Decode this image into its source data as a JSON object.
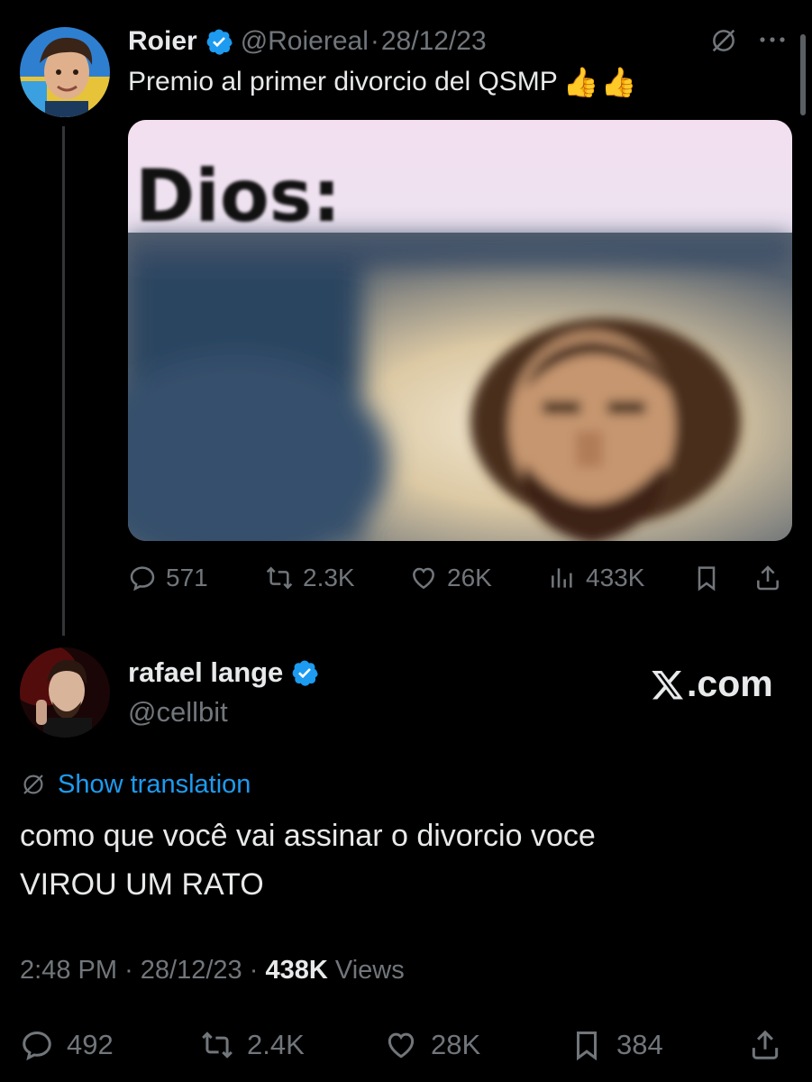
{
  "quoted_tweet": {
    "author_name": "Roier",
    "author_handle": "@Roiereal",
    "separator": "·",
    "date": "28/12/23",
    "text": "Premio al primer divorcio del QSMP",
    "emoji": [
      "👍",
      "👍"
    ],
    "media_caption": "Dios:",
    "stats": {
      "replies": "571",
      "reposts": "2.3K",
      "likes": "26K",
      "views": "433K"
    },
    "icons": [
      "verified-badge-icon",
      "translate-icon",
      "more-icon",
      "reply-icon",
      "repost-icon",
      "like-icon",
      "views-icon",
      "bookmark-icon",
      "share-icon"
    ]
  },
  "main_tweet": {
    "author_name": "rafael lange",
    "author_handle": "@cellbit",
    "brand_suffix": ".com",
    "show_translation": "Show translation",
    "text_lines": [
      "como que você vai assinar o divorcio voce",
      "VIROU UM RATO"
    ],
    "time": "2:48 PM",
    "separator": "·",
    "date": "28/12/23",
    "views_count": "438K",
    "views_label": "Views",
    "stats": {
      "replies": "492",
      "reposts": "2.4K",
      "likes": "28K",
      "bookmarks": "384"
    }
  },
  "colors": {
    "background": "#000000",
    "text": "#e7e9ea",
    "muted": "#71767b",
    "link": "#1d9bf0",
    "verified": "#1d9bf0"
  }
}
